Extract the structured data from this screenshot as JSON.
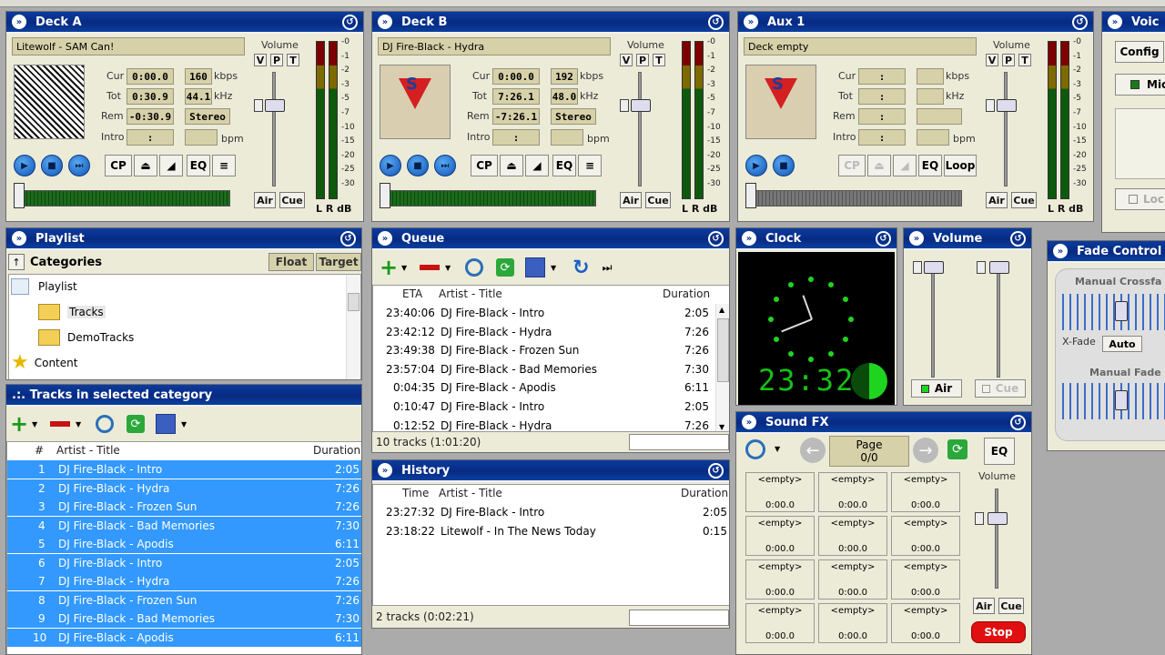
{
  "decks": [
    {
      "title": "Deck A",
      "track": "Litewolf - SAM Can!",
      "cur": "0:00.0",
      "tot": "0:30.9",
      "rem": "-0:30.9",
      "intro": ":",
      "kbps": "160",
      "khz": "44.1",
      "mode": "Stereo",
      "bpm": "bpm",
      "loop": ""
    },
    {
      "title": "Deck B",
      "track": "DJ Fire-Black - Hydra",
      "cur": "0:00.0",
      "tot": "7:26.1",
      "rem": "-7:26.1",
      "intro": ":",
      "kbps": "192",
      "khz": "48.0",
      "mode": "Stereo",
      "bpm": "bpm",
      "loop": ""
    },
    {
      "title": "Aux 1",
      "track": "Deck empty",
      "cur": ":",
      "tot": ":",
      "rem": ":",
      "intro": ":",
      "kbps": "",
      "khz": "",
      "mode": "",
      "bpm": "bpm",
      "loop": "Loop"
    }
  ],
  "deck_labels": {
    "cur": "Cur",
    "tot": "Tot",
    "rem": "Rem",
    "intro": "Intro",
    "kbps": "kbps",
    "khz": "kHz",
    "volume": "Volume",
    "v": "V",
    "p": "P",
    "t": "T",
    "cp": "CP",
    "eq": "EQ",
    "air": "Air",
    "cue": "Cue",
    "lr": "L R dB"
  },
  "vu_scale": [
    "-0",
    "-1",
    "-2",
    "-3",
    "-5",
    "-7",
    "-10",
    "-15",
    "-20",
    "-25",
    "-30"
  ],
  "voice": {
    "title": "Voic",
    "config": "Config",
    "mic": "Mic",
    "lock": "Loc"
  },
  "playlist": {
    "title": "Playlist",
    "categories": "Categories",
    "float": "Float",
    "target": "Target",
    "tree": [
      {
        "label": "Playlist",
        "level": 0
      },
      {
        "label": "Tracks",
        "level": 1
      },
      {
        "label": "DemoTracks",
        "level": 1
      },
      {
        "label": "Content",
        "level": 0
      }
    ]
  },
  "tracks_panel": {
    "title": ".:. Tracks in selected category",
    "col_num": "#",
    "col_title": "Artist - Title",
    "col_duration": "Duration",
    "rows": [
      {
        "n": "1",
        "title": "DJ Fire-Black - Intro",
        "dur": "2:05"
      },
      {
        "n": "2",
        "title": "DJ Fire-Black - Hydra",
        "dur": "7:26"
      },
      {
        "n": "3",
        "title": "DJ Fire-Black - Frozen Sun",
        "dur": "7:26"
      },
      {
        "n": "4",
        "title": "DJ Fire-Black - Bad Memories",
        "dur": "7:30"
      },
      {
        "n": "5",
        "title": "DJ Fire-Black - Apodis",
        "dur": "6:11"
      },
      {
        "n": "6",
        "title": "DJ Fire-Black - Intro",
        "dur": "2:05"
      },
      {
        "n": "7",
        "title": "DJ Fire-Black - Hydra",
        "dur": "7:26"
      },
      {
        "n": "8",
        "title": "DJ Fire-Black - Frozen Sun",
        "dur": "7:26"
      },
      {
        "n": "9",
        "title": "DJ Fire-Black - Bad Memories",
        "dur": "7:30"
      },
      {
        "n": "10",
        "title": "DJ Fire-Black - Apodis",
        "dur": "6:11"
      }
    ]
  },
  "queue": {
    "title": "Queue",
    "col_eta": "ETA",
    "col_title": "Artist - Title",
    "col_duration": "Duration",
    "status": "10 tracks (1:01:20)",
    "rows": [
      {
        "eta": "23:40:06",
        "title": "DJ Fire-Black - Intro",
        "dur": "2:05"
      },
      {
        "eta": "23:42:12",
        "title": "DJ Fire-Black - Hydra",
        "dur": "7:26"
      },
      {
        "eta": "23:49:38",
        "title": "DJ Fire-Black - Frozen Sun",
        "dur": "7:26"
      },
      {
        "eta": "23:57:04",
        "title": "DJ Fire-Black - Bad Memories",
        "dur": "7:30"
      },
      {
        "eta": "0:04:35",
        "title": "DJ Fire-Black - Apodis",
        "dur": "6:11"
      },
      {
        "eta": "0:10:47",
        "title": "DJ Fire-Black - Intro",
        "dur": "2:05"
      },
      {
        "eta": "0:12:52",
        "title": "DJ Fire-Black - Hydra",
        "dur": "7:26"
      }
    ]
  },
  "history": {
    "title": "History",
    "col_time": "Time",
    "col_title": "Artist - Title",
    "col_duration": "Duration",
    "status": "2 tracks (0:02:21)",
    "rows": [
      {
        "time": "23:27:32",
        "title": "DJ Fire-Black - Intro",
        "dur": "2:05"
      },
      {
        "time": "23:18:22",
        "title": "Litewolf - In The News Today",
        "dur": "0:15"
      }
    ]
  },
  "clock": {
    "title": "Clock",
    "time": "23:32"
  },
  "volume": {
    "title": "Volume",
    "air": "Air",
    "cue": "Cue"
  },
  "fade": {
    "title": "Fade Control",
    "manual_crossfade": "Manual Crossfa",
    "xfade": "X-Fade",
    "auto": "Auto",
    "manual_fade": "Manual Fade"
  },
  "sound_fx": {
    "title": "Sound FX",
    "page_label": "Page",
    "page_value": "0/0",
    "eq": "EQ",
    "volume": "Volume",
    "air": "Air",
    "cue": "Cue",
    "stop": "Stop",
    "slots": [
      {
        "name": "<empty>",
        "time": "0:00.0"
      },
      {
        "name": "<empty>",
        "time": "0:00.0"
      },
      {
        "name": "<empty>",
        "time": "0:00.0"
      },
      {
        "name": "<empty>",
        "time": "0:00.0"
      },
      {
        "name": "<empty>",
        "time": "0:00.0"
      },
      {
        "name": "<empty>",
        "time": "0:00.0"
      },
      {
        "name": "<empty>",
        "time": "0:00.0"
      },
      {
        "name": "<empty>",
        "time": "0:00.0"
      },
      {
        "name": "<empty>",
        "time": "0:00.0"
      },
      {
        "name": "<empty>",
        "time": "0:00.0"
      },
      {
        "name": "<empty>",
        "time": "0:00.0"
      },
      {
        "name": "<empty>",
        "time": "0:00.0"
      }
    ]
  },
  "colors": {
    "titlebar": "#0a3a9a",
    "selection": "#3399ff",
    "led_green": "#1fd41f",
    "stop_red": "#e01010"
  }
}
